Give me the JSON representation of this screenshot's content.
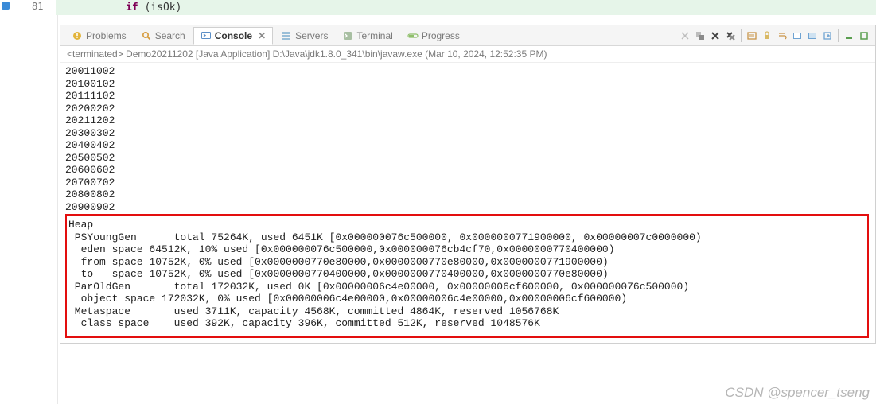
{
  "editor": {
    "line_number": "81",
    "keyword": "if",
    "rest": " (isOk)"
  },
  "tabs": [
    {
      "label": "Problems",
      "icon": "warning"
    },
    {
      "label": "Search",
      "icon": "search"
    },
    {
      "label": "Console",
      "icon": "console",
      "active": true
    },
    {
      "label": "Servers",
      "icon": "servers"
    },
    {
      "label": "Terminal",
      "icon": "terminal"
    },
    {
      "label": "Progress",
      "icon": "progress"
    }
  ],
  "context_line": "<terminated> Demo20211202 [Java Application] D:\\Java\\jdk1.8.0_341\\bin\\javaw.exe (Mar 10, 2024, 12:52:35 PM)",
  "console_numbers": [
    "20011002",
    "20100102",
    "20111102",
    "20200202",
    "20211202",
    "20300302",
    "20400402",
    "20500502",
    "20600602",
    "20700702",
    "20800802",
    "20900902"
  ],
  "heap_lines": [
    "Heap",
    " PSYoungGen      total 75264K, used 6451K [0x000000076c500000, 0x0000000771900000, 0x00000007c0000000)",
    "  eden space 64512K, 10% used [0x000000076c500000,0x000000076cb4cf70,0x0000000770400000)",
    "  from space 10752K, 0% used [0x0000000770e80000,0x0000000770e80000,0x0000000771900000)",
    "  to   space 10752K, 0% used [0x0000000770400000,0x0000000770400000,0x0000000770e80000)",
    " ParOldGen       total 172032K, used 0K [0x00000006c4e00000, 0x00000006cf600000, 0x000000076c500000)",
    "  object space 172032K, 0% used [0x00000006c4e00000,0x00000006c4e00000,0x00000006cf600000)",
    " Metaspace       used 3711K, capacity 4568K, committed 4864K, reserved 1056768K",
    "  class space    used 392K, capacity 396K, committed 512K, reserved 1048576K"
  ],
  "toolbar_icons": [
    "cross-out",
    "remove-all",
    "remove",
    "scroll-lock",
    "sep",
    "clear-console",
    "display",
    "open",
    "pin",
    "sep",
    "minimize",
    "maximize",
    "sep",
    "menu"
  ],
  "watermark": "CSDN @spencer_tseng"
}
